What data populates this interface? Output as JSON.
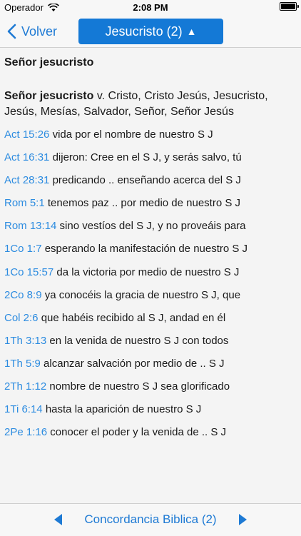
{
  "status_bar": {
    "carrier": "Operador",
    "time": "2:08 PM"
  },
  "nav": {
    "back_label": "Volver",
    "title": "Jesucristo (2)",
    "title_caret": "▲"
  },
  "content": {
    "heading": "Señor jesucristo",
    "definition_term": "Señor jesucristo",
    "definition_text": " v. Cristo, Cristo Jesús, Jesucristo, Jesús, Mesías, Salvador, Señor, Señor Jesús",
    "references": [
      {
        "ref": "Act 15:26",
        "text": "vida por el nombre de nuestro S J"
      },
      {
        "ref": "Act 16:31",
        "text": "dijeron: Cree en el S J, y serás salvo, tú"
      },
      {
        "ref": "Act 28:31",
        "text": "predicando .. enseñando acerca del S J"
      },
      {
        "ref": "Rom 5:1",
        "text": "tenemos paz .. por medio de nuestro S J"
      },
      {
        "ref": "Rom 13:14",
        "text": "sino vestíos del S J, y no proveáis para"
      },
      {
        "ref": "1Co 1:7",
        "text": "esperando la manifestación de nuestro S J"
      },
      {
        "ref": "1Co 15:57",
        "text": "da la victoria por medio de nuestro S J"
      },
      {
        "ref": "2Co 8:9",
        "text": "ya conocéis la gracia de nuestro S J, que"
      },
      {
        "ref": "Col 2:6",
        "text": "que habéis recibido al S J, andad en él"
      },
      {
        "ref": "1Th 3:13",
        "text": "en la venida de nuestro S J con todos"
      },
      {
        "ref": "1Th 5:9",
        "text": "alcanzar salvación por medio de .. S J"
      },
      {
        "ref": "2Th 1:12",
        "text": "nombre de nuestro S J sea glorificado"
      },
      {
        "ref": "1Ti 6:14",
        "text": "hasta la aparición de nuestro S J"
      },
      {
        "ref": "2Pe 1:16",
        "text": "conocer el poder y la venida de .. S J"
      }
    ]
  },
  "toolbar": {
    "label": "Concordancia Biblica (2)"
  },
  "colors": {
    "accent": "#1e7ad4",
    "title_button": "#1479d6",
    "link": "#2d8ce0"
  }
}
